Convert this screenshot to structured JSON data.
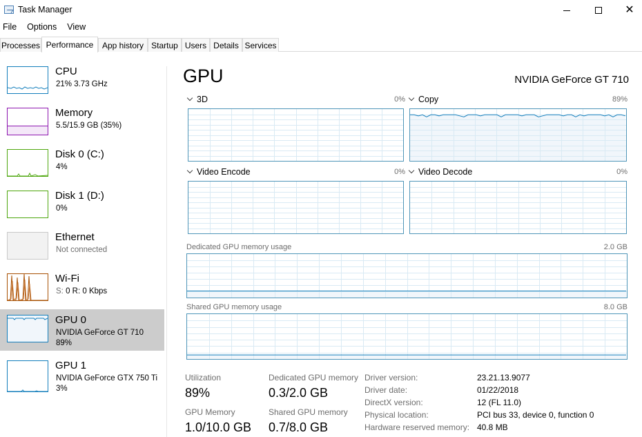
{
  "window": {
    "title": "Task Manager",
    "minimize_icon": "minimize-icon",
    "maximize_icon": "maximize-icon",
    "close_glyph": "✕"
  },
  "menu": [
    "File",
    "Options",
    "View"
  ],
  "tabs": [
    "Processes",
    "Performance",
    "App history",
    "Startup",
    "Users",
    "Details",
    "Services"
  ],
  "active_tab": "Performance",
  "sidebar": [
    {
      "title": "CPU",
      "sub": "21%  3.73 GHz",
      "color": "#117dbb"
    },
    {
      "title": "Memory",
      "sub": "5.5/15.9 GB (35%)",
      "color": "#8b12ae"
    },
    {
      "title": "Disk 0 (C:)",
      "sub": "4%",
      "color": "#4da60c"
    },
    {
      "title": "Disk 1 (D:)",
      "sub": "0%",
      "color": "#4da60c"
    },
    {
      "title": "Ethernet",
      "sub": "Not connected",
      "color": "#c8c8c8"
    },
    {
      "title": "Wi-Fi",
      "sub_prefix": "S: ",
      "sub": "0  R: 0 Kbps",
      "color": "#a74f01"
    },
    {
      "title": "GPU 0",
      "sub": "NVIDIA GeForce GT 710",
      "sub2": "89%",
      "color": "#117dbb"
    },
    {
      "title": "GPU 1",
      "sub": "NVIDIA GeForce GTX 750 Ti",
      "sub2": "3%",
      "color": "#117dbb"
    }
  ],
  "main": {
    "title": "GPU",
    "device": "NVIDIA GeForce GT 710",
    "engines": [
      {
        "name": "3D",
        "pct": "0%",
        "level": 0
      },
      {
        "name": "Copy",
        "pct": "89%",
        "level": 0.89
      },
      {
        "name": "Video Encode",
        "pct": "0%",
        "level": 0
      },
      {
        "name": "Video Decode",
        "pct": "0%",
        "level": 0
      }
    ],
    "dedicated": {
      "label": "Dedicated GPU memory usage",
      "max": "2.0 GB",
      "level": 0.15
    },
    "shared": {
      "label": "Shared GPU memory usage",
      "max": "8.0 GB",
      "level": 0.09
    }
  },
  "stats": {
    "utilization_label": "Utilization",
    "utilization": "89%",
    "dedicated_label": "Dedicated GPU memory",
    "dedicated": "0.3/2.0 GB",
    "gpu_memory_label": "GPU Memory",
    "gpu_memory": "1.0/10.0 GB",
    "shared_label": "Shared GPU memory",
    "shared": "0.7/8.0 GB"
  },
  "info": [
    {
      "label": "Driver version:",
      "value": "23.21.13.9077"
    },
    {
      "label": "Driver date:",
      "value": "01/22/2018"
    },
    {
      "label": "DirectX version:",
      "value": "12 (FL 11.0)"
    },
    {
      "label": "Physical location:",
      "value": "PCI bus 33, device 0, function 0"
    },
    {
      "label": "Hardware reserved memory:",
      "value": "40.8 MB"
    }
  ]
}
